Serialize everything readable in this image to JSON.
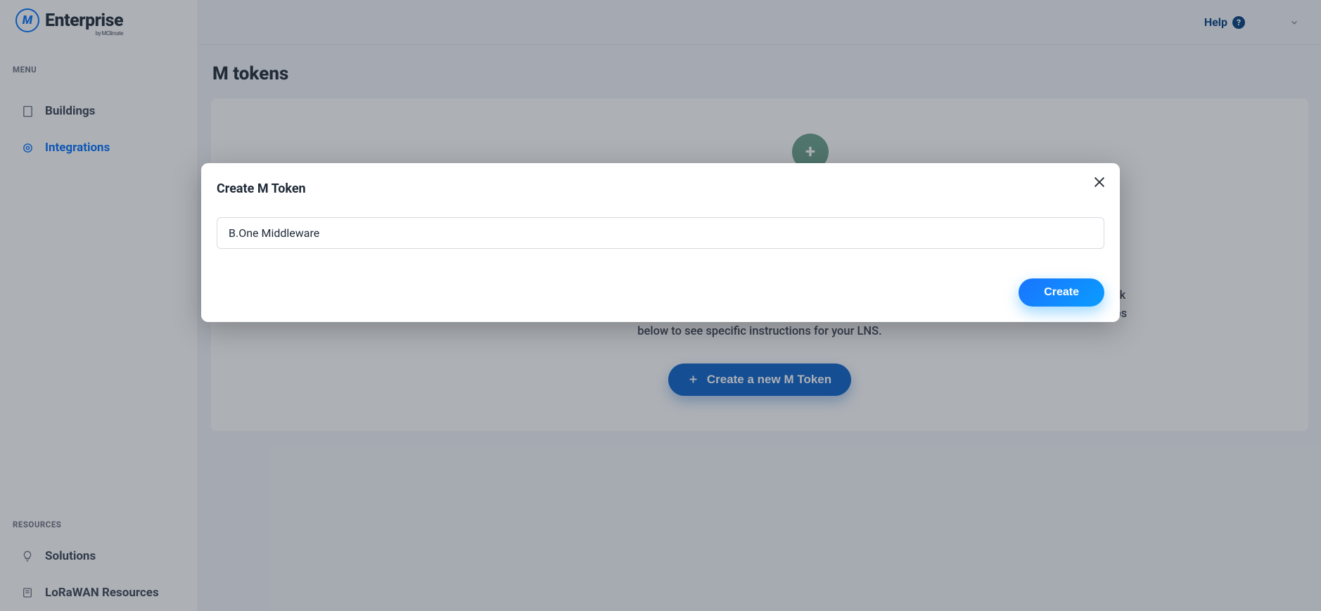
{
  "brand": {
    "badge_letter": "M",
    "name": "Enterprise",
    "subtitle": "by MClimate"
  },
  "sidebar": {
    "menu_heading": "MENU",
    "items": [
      {
        "label": "Buildings"
      },
      {
        "label": "Integrations"
      }
    ],
    "resources_heading": "RESOURCES",
    "resources": [
      {
        "label": "Solutions"
      },
      {
        "label": "LoRaWAN Resources"
      }
    ]
  },
  "topbar": {
    "help": "Help"
  },
  "page": {
    "title": "M tokens",
    "explain": "If you want to start streaming device data to the Enterprise and vice-versa, you need to create an integration between your LoRaWAN Network Server (LNS) and our server. For this, you will require an M Token, which will secure the connection between the two systems. Follow the steps below to see specific instructions for your LNS.",
    "create_button": "Create a new M Token"
  },
  "modal": {
    "title": "Create M Token",
    "input_value": "B.One Middleware",
    "submit": "Create"
  }
}
